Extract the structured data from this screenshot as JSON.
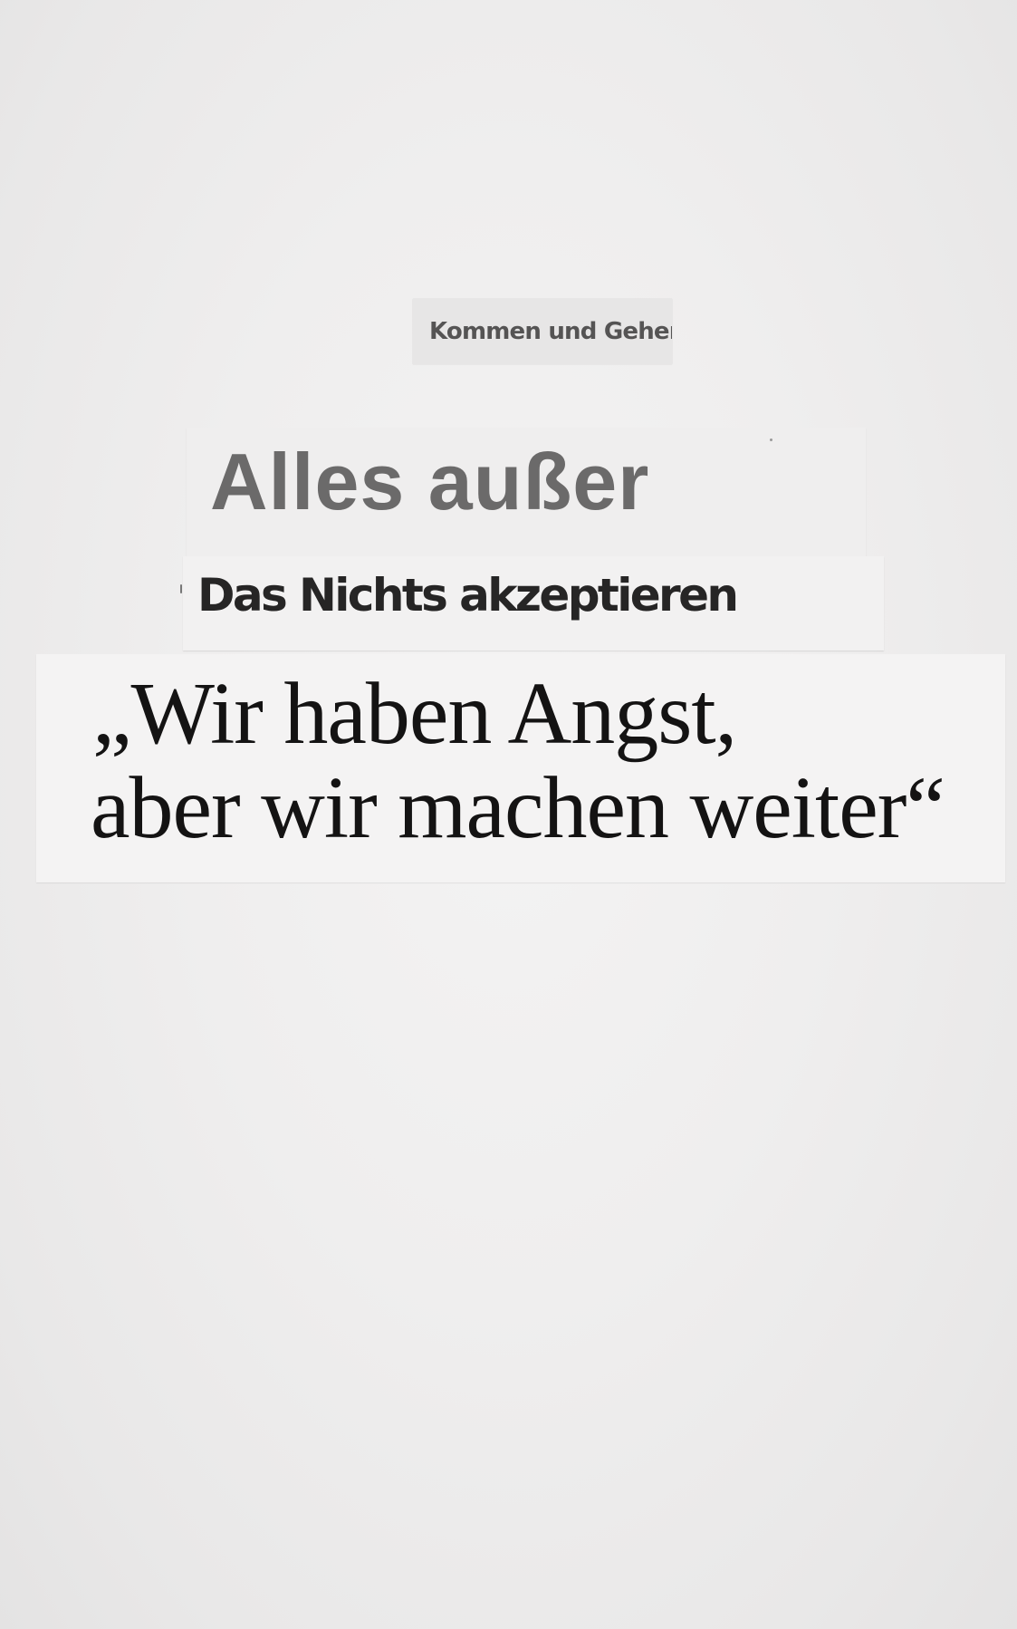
{
  "clippings": {
    "kicker": "Kommen und Gehen",
    "headline": "Alles außer",
    "subhead": "Das Nichts akzeptieren",
    "quote_line_1": "„Wir haben Angst,",
    "quote_line_2": "aber wir machen weiter“"
  }
}
